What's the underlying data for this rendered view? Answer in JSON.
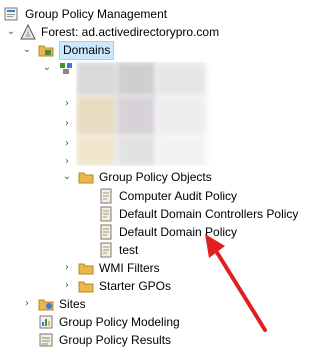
{
  "tree": {
    "root_label": "Group Policy Management",
    "forest_label": "Forest: ad.activedirectorypro.com",
    "domains_label": "Domains",
    "gpo_container_label": "Group Policy Objects",
    "gpos": [
      {
        "label": "Computer Audit Policy"
      },
      {
        "label": "Default Domain Controllers Policy"
      },
      {
        "label": "Default Domain Policy"
      },
      {
        "label": "test"
      }
    ],
    "wmi_label": "WMI Filters",
    "starter_label": "Starter GPOs",
    "sites_label": "Sites",
    "modeling_label": "Group Policy Modeling",
    "results_label": "Group Policy Results"
  },
  "annotation": {
    "arrow_color": "#e02020"
  },
  "colors": {
    "selection_bg": "#cce8ff",
    "selection_border": "#99d1ff",
    "folder": "#e8b84a"
  }
}
